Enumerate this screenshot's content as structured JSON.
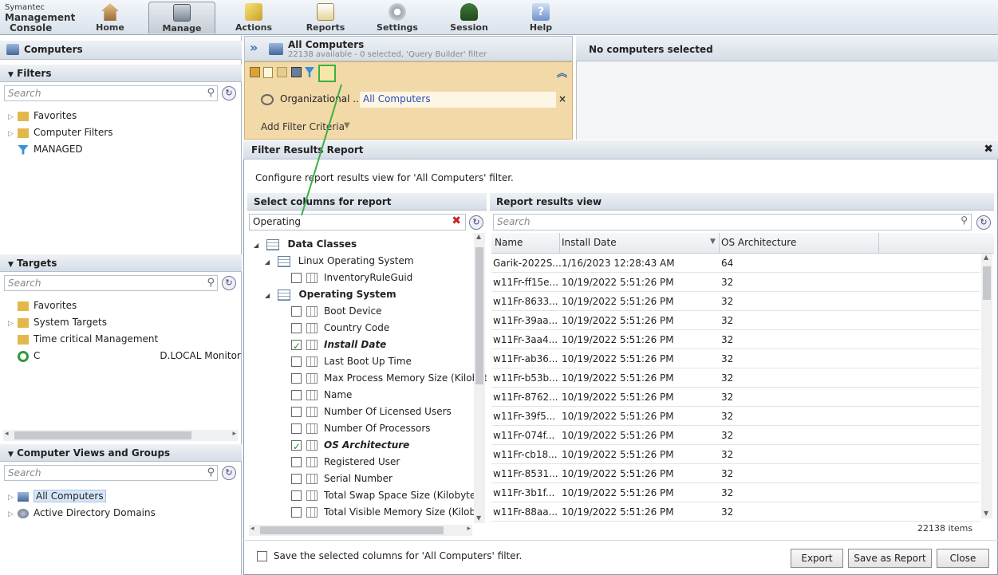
{
  "logo": {
    "line1": "Symantec",
    "line2": "Management",
    "line3": "Console"
  },
  "nav": [
    {
      "label": "Home",
      "icon": "home-icon"
    },
    {
      "label": "Manage",
      "icon": "manage-icon"
    },
    {
      "label": "Actions",
      "icon": "actions-icon"
    },
    {
      "label": "Reports",
      "icon": "reports-icon"
    },
    {
      "label": "Settings",
      "icon": "settings-icon"
    },
    {
      "label": "Session",
      "icon": "session-icon"
    },
    {
      "label": "Help",
      "icon": "help-icon"
    }
  ],
  "left": {
    "title": "Computers",
    "filters": {
      "title": "Filters",
      "search_placeholder": "Search",
      "items": [
        "Favorites",
        "Computer Filters",
        "MANAGED"
      ]
    },
    "targets": {
      "title": "Targets",
      "search_placeholder": "Search",
      "items": [
        "Favorites",
        "System Targets",
        "Time critical Management",
        "D.LOCAL Monitor S"
      ],
      "first_prefix": "C"
    },
    "views": {
      "title": "Computer Views and Groups",
      "search_placeholder": "Search",
      "items": [
        "All Computers",
        "Active Directory Domains"
      ]
    }
  },
  "main": {
    "title": "All Computers",
    "subtitle": "22138 available - 0 selected, 'Query Builder' filter",
    "filter_label": "Organizational ...",
    "filter_value": "All Computers",
    "add_filter": "Add Filter Criteria"
  },
  "right": {
    "header": "No computers selected"
  },
  "dialog": {
    "title": "Filter Results Report",
    "description": "Configure report results view for 'All Computers' filter.",
    "select_header": "Select columns for report",
    "select_search": "Operating",
    "tree": {
      "root": "Data Classes",
      "linux": "Linux Operating System",
      "linux_items": [
        {
          "label": "InventoryRuleGuid",
          "checked": false
        }
      ],
      "os": "Operating System",
      "os_items": [
        {
          "label": "Boot Device",
          "checked": false
        },
        {
          "label": "Country Code",
          "checked": false
        },
        {
          "label": "Install Date",
          "checked": true
        },
        {
          "label": "Last Boot Up Time",
          "checked": false
        },
        {
          "label": "Max Process Memory Size (Kilobyt",
          "checked": false
        },
        {
          "label": "Name",
          "checked": false
        },
        {
          "label": "Number Of Licensed Users",
          "checked": false
        },
        {
          "label": "Number Of Processors",
          "checked": false
        },
        {
          "label": "OS Architecture",
          "checked": true
        },
        {
          "label": "Registered User",
          "checked": false
        },
        {
          "label": "Serial Number",
          "checked": false
        },
        {
          "label": "Total Swap Space Size (Kilobytes)",
          "checked": false
        },
        {
          "label": "Total Visible Memory Size (Kilobyt",
          "checked": false
        }
      ]
    },
    "results_header": "Report results view",
    "results_search_placeholder": "Search",
    "columns": [
      "Name",
      "Install Date",
      "OS Architecture"
    ],
    "rows": [
      [
        "Garik-2022S...",
        "1/16/2023 12:28:43 AM",
        "64"
      ],
      [
        "w11Fr-ff15e...",
        "10/19/2022 5:51:26 PM",
        "32"
      ],
      [
        "w11Fr-8633...",
        "10/19/2022 5:51:26 PM",
        "32"
      ],
      [
        "w11Fr-39aa...",
        "10/19/2022 5:51:26 PM",
        "32"
      ],
      [
        "w11Fr-3aa4...",
        "10/19/2022 5:51:26 PM",
        "32"
      ],
      [
        "w11Fr-ab36...",
        "10/19/2022 5:51:26 PM",
        "32"
      ],
      [
        "w11Fr-b53b...",
        "10/19/2022 5:51:26 PM",
        "32"
      ],
      [
        "w11Fr-8762...",
        "10/19/2022 5:51:26 PM",
        "32"
      ],
      [
        "w11Fr-39f5...",
        "10/19/2022 5:51:26 PM",
        "32"
      ],
      [
        "w11Fr-074f...",
        "10/19/2022 5:51:26 PM",
        "32"
      ],
      [
        "w11Fr-cb18...",
        "10/19/2022 5:51:26 PM",
        "32"
      ],
      [
        "w11Fr-8531...",
        "10/19/2022 5:51:26 PM",
        "32"
      ],
      [
        "w11Fr-3b1f...",
        "10/19/2022 5:51:26 PM",
        "32"
      ],
      [
        "w11Fr-88aa...",
        "10/19/2022 5:51:26 PM",
        "32"
      ]
    ],
    "item_count": "22138 items",
    "save_columns_label": "Save the selected columns for 'All Computers' filter.",
    "buttons": {
      "export": "Export",
      "save_report": "Save as Report",
      "close": "Close"
    }
  },
  "colors": {
    "accent": "#2a8a2a",
    "filterbar": "#f2d9a8",
    "highlight_box": "#3cb043"
  }
}
